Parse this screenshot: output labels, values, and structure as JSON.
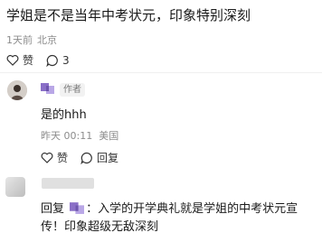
{
  "post": {
    "text": "学姐是不是当年中考状元，印象特别深刻",
    "time": "1天前",
    "location": "北京",
    "like_label": "赞",
    "comment_count": "3"
  },
  "reply1": {
    "author_badge": "作者",
    "text": "是的hhh",
    "time": "昨天 00:11",
    "location": "美国",
    "like_label": "赞",
    "reply_label": "回复"
  },
  "reply2": {
    "prefix": "回复",
    "text": "：入学的开学典礼就是学姐的中考状元宣传！印象超级无敌深刻"
  },
  "colors": {
    "meta_gray": "#8c8c8c",
    "accent_purple": "#8a6fc7"
  }
}
